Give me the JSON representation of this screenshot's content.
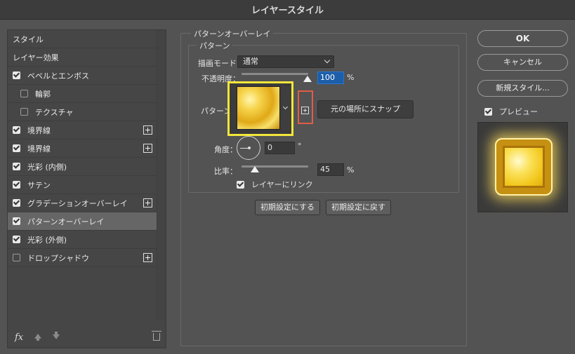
{
  "window": {
    "title": "レイヤースタイル"
  },
  "left": {
    "items": [
      {
        "label": "スタイル",
        "checkbox": null,
        "plus": false,
        "indent": false,
        "selected": false
      },
      {
        "label": "レイヤー効果",
        "checkbox": null,
        "plus": false,
        "indent": false,
        "selected": false
      },
      {
        "label": "ベベルとエンボス",
        "checkbox": true,
        "plus": false,
        "indent": false,
        "selected": false
      },
      {
        "label": "輪郭",
        "checkbox": false,
        "plus": false,
        "indent": true,
        "selected": false
      },
      {
        "label": "テクスチャ",
        "checkbox": false,
        "plus": false,
        "indent": true,
        "selected": false
      },
      {
        "label": "境界線",
        "checkbox": true,
        "plus": true,
        "indent": false,
        "selected": false
      },
      {
        "label": "境界線",
        "checkbox": true,
        "plus": true,
        "indent": false,
        "selected": false
      },
      {
        "label": "光彩 (内側)",
        "checkbox": true,
        "plus": false,
        "indent": false,
        "selected": false
      },
      {
        "label": "サテン",
        "checkbox": true,
        "plus": false,
        "indent": false,
        "selected": false
      },
      {
        "label": "グラデーションオーバーレイ",
        "checkbox": true,
        "plus": true,
        "indent": false,
        "selected": false
      },
      {
        "label": "パターンオーバーレイ",
        "checkbox": true,
        "plus": false,
        "indent": false,
        "selected": true
      },
      {
        "label": "光彩 (外側)",
        "checkbox": true,
        "plus": false,
        "indent": false,
        "selected": false
      },
      {
        "label": "ドロップシャドウ",
        "checkbox": false,
        "plus": true,
        "indent": false,
        "selected": false
      }
    ],
    "fx_label": "fx"
  },
  "panel": {
    "group_title": "パターンオーバーレイ",
    "subgroup_title": "パターン",
    "blend_mode_label": "描画モード：",
    "blend_mode_value": "通常",
    "opacity_label": "不透明度：",
    "opacity_value": "100",
    "opacity_unit": "%",
    "opacity_fraction": 1.0,
    "pattern_label": "パターン：",
    "snap_button": "元の場所にスナップ",
    "angle_label": "角度：",
    "angle_value": "0",
    "angle_unit": "°",
    "scale_label": "比率：",
    "scale_value": "45",
    "scale_unit": "%",
    "scale_fraction": 0.045,
    "link_label": "レイヤーにリンク",
    "link_checked": true,
    "default_set_button": "初期設定にする",
    "default_reset_button": "初期設定に戻す"
  },
  "right": {
    "ok": "OK",
    "cancel": "キャンセル",
    "new_style": "新規スタイル...",
    "preview_label": "プレビュー",
    "preview_checked": true
  },
  "colors": {
    "highlight_yellow": "#f2e63a",
    "highlight_red": "#e25c4a",
    "selection_blue": "#1d5ea8",
    "gold": "#f2c81e"
  }
}
